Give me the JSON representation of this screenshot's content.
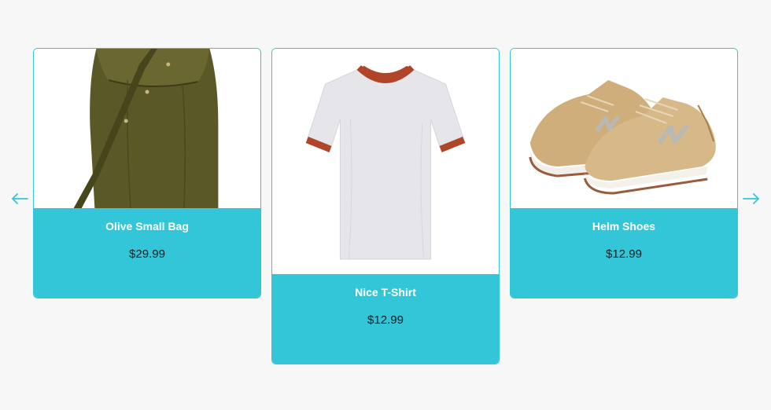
{
  "carousel": {
    "prev_icon": "arrow-left-icon",
    "next_icon": "arrow-right-icon",
    "accent_color": "#33c6d9",
    "products": [
      {
        "name": "Olive Small Bag",
        "price": "$29.99",
        "image": "olive-bucket-bag"
      },
      {
        "name": "Nice T-Shirt",
        "price": "$12.99",
        "image": "white-ringer-tshirt"
      },
      {
        "name": "Helm Shoes",
        "price": "$12.99",
        "image": "tan-sneakers"
      }
    ]
  }
}
